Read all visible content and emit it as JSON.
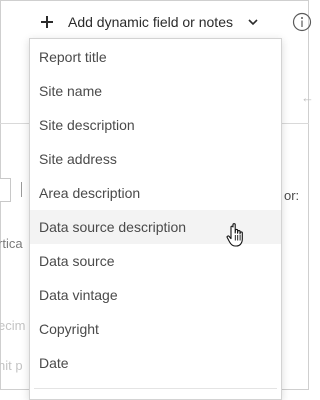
{
  "toolbar": {
    "add_label": "Add dynamic field or notes",
    "icons": [
      "plus-icon",
      "chevron-down-icon",
      "info-icon"
    ]
  },
  "background": {
    "or_label": "or:",
    "vertical_label": "rtica",
    "decimal_label": "ecim",
    "unit_label": "nit p",
    "back_arrow": "←"
  },
  "menu": {
    "items": [
      {
        "label": "Report title"
      },
      {
        "label": "Site name"
      },
      {
        "label": "Site description"
      },
      {
        "label": "Site address"
      },
      {
        "label": "Area description"
      },
      {
        "label": "Data source description",
        "hovered": true
      },
      {
        "label": "Data source"
      },
      {
        "label": "Data vintage"
      },
      {
        "label": "Copyright"
      },
      {
        "label": "Date"
      }
    ]
  },
  "colors": {
    "text": "#4a4a4a",
    "hover_bg": "#f3f3f3",
    "border": "#d3d3d3"
  }
}
